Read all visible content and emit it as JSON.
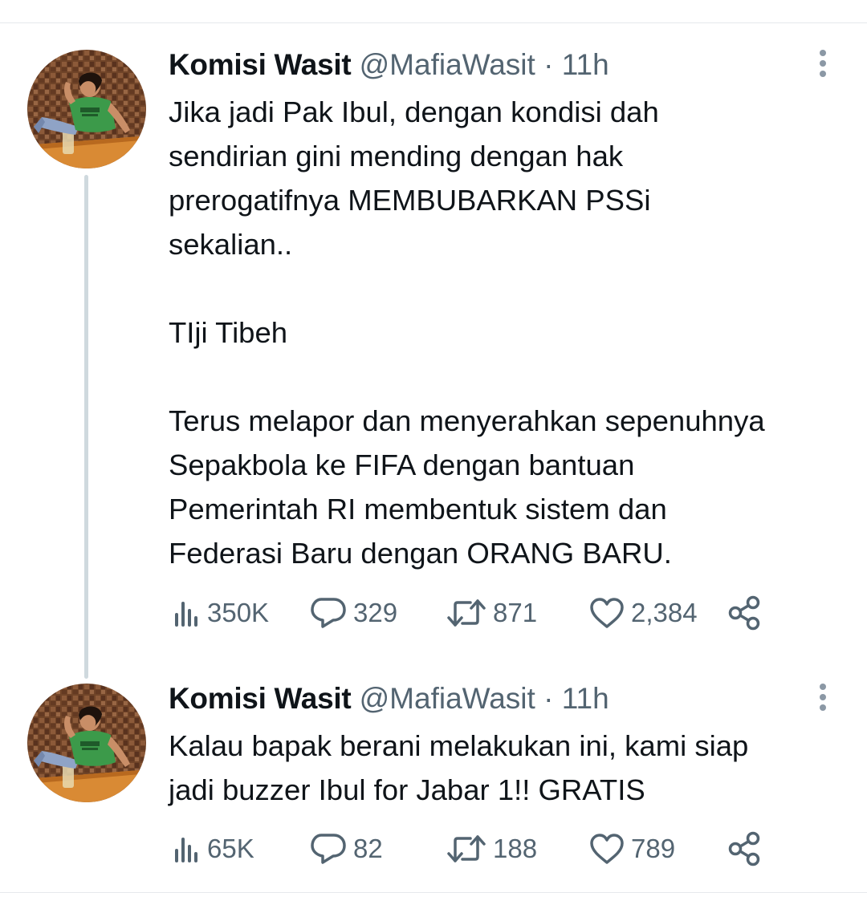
{
  "tweets": [
    {
      "author_name": "Komisi Wasit",
      "handle": "@MafiaWasit",
      "separator": "·",
      "time": "11h",
      "text": "Jika jadi Pak Ibul, dengan kondisi dah\nsendirian gini mending dengan hak\nprerogatifnya MEMBUBARKAN PSSi\nsekalian..\n\nTIji Tibeh\n\nTerus melapor dan menyerahkan sepenuhnya\nSepakbola ke FIFA dengan bantuan\nPemerintah RI membentuk sistem dan\nFederasi Baru dengan ORANG BARU.",
      "stats": {
        "views": "350K",
        "replies": "329",
        "retweets": "871",
        "likes": "2,384"
      }
    },
    {
      "author_name": "Komisi Wasit",
      "handle": "@MafiaWasit",
      "separator": "·",
      "time": "11h",
      "text": "Kalau bapak berani melakukan ini, kami siap\njadi buzzer Ibul for Jabar 1!! GRATIS",
      "stats": {
        "views": "65K",
        "replies": "82",
        "retweets": "188",
        "likes": "789"
      }
    }
  ],
  "icons": {
    "views": "views-bar-chart-icon",
    "reply": "reply-bubble-icon",
    "retweet": "retweet-arrows-icon",
    "like": "heart-icon",
    "share": "share-nodes-icon",
    "more": "more-vertical-dots-icon"
  },
  "colors": {
    "text_primary": "#0f1419",
    "text_secondary": "#536471",
    "thread_line": "#cfd9de",
    "divider": "#e6e9ec"
  }
}
